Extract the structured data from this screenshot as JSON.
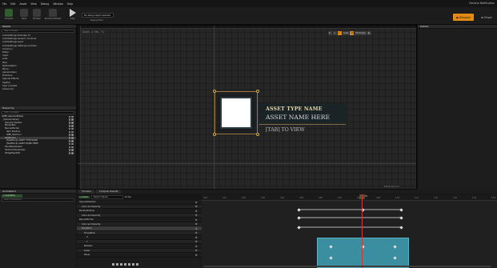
{
  "menu": [
    "File",
    "Edit",
    "Asset",
    "View",
    "Debug",
    "Window",
    "Help"
  ],
  "notification": "General Notification",
  "toolbar": {
    "buttons": [
      "Compile",
      "Save",
      "Browse",
      "Window Refresh",
      "Play"
    ],
    "debug_placeholder": "No debug object selected",
    "debug_label": "Debug Filter"
  },
  "modes": {
    "designer": "Designer",
    "graph": "Graph"
  },
  "palette": {
    "title": "Palette",
    "search_placeholder": "Search Palette",
    "items": [
      "AutoSettings Example UI",
      "AutoSettings Generic Controls",
      "AutoSettings Input",
      "AutoSettings Settings Controls",
      "Common",
      "Editor",
      "Input",
      "Lists",
      "Misc",
      "Optimization",
      "Panel",
      "placeholders",
      "Primitive",
      "Special Effects",
      "Spatial",
      "User Created",
      "Advanced"
    ]
  },
  "hierarchy": {
    "title": "Hierarchy",
    "search_placeholder": "Search Widgets",
    "items": [
      "[WBP_SelectedMask]",
      "[Canvas Panel]",
      "General Shadow",
      "BorderBox",
      "BannerBorder",
      "Item Shadow",
      "WBP_ItemIcon",
      "TextBorder",
      "[TextBlock] ASSET TYPE NAME",
      "[TextBlock] ASSET NAME HERE",
      "HorizPlaceholder",
      "Vertical Placeholder",
      "WidgetSpotlite"
    ]
  },
  "designer": {
    "zoom": "Zoom -2",
    "mode": "Mo - 71",
    "dpi": "DPI Scale 1.0",
    "tools": [
      "R",
      "≡",
      "1",
      "Scale",
      "10",
      "Fill Screen",
      "▣"
    ]
  },
  "widget_preview": {
    "type_name": "ASSET TYPE NAME",
    "asset_name": "ASSET NAME HERE",
    "hint": "[TAB] TO VIEW"
  },
  "details": {
    "title": "Details"
  },
  "animations": {
    "title": "Animations",
    "new_label": "+ Animation",
    "search_placeholder": "Search Animations"
  },
  "timeline": {
    "tabs": [
      "Timeline",
      "Compiler Results"
    ],
    "fps": "20 fps",
    "track_btn": "+ Track",
    "filter_placeholder": "Search Tracks",
    "tracks": [
      "GeneralShadow",
      "Color and Opacity",
      "BorderShadow",
      "Color and Opacity",
      "BannerBorder",
      "Color and Opacity",
      "Transform",
      "Translation",
      "X",
      "Y",
      "Rotation",
      "Scale",
      "Shear"
    ],
    "ticks": [
      "0.00",
      "0.10",
      "0.20",
      "0.30",
      "0.40",
      "0.50",
      "0.60",
      "0.70",
      "0.80",
      "0.90",
      "1.00",
      "1.10",
      "1.20",
      "1.30",
      "1.40",
      "1.50"
    ],
    "current_time": "0.50"
  }
}
